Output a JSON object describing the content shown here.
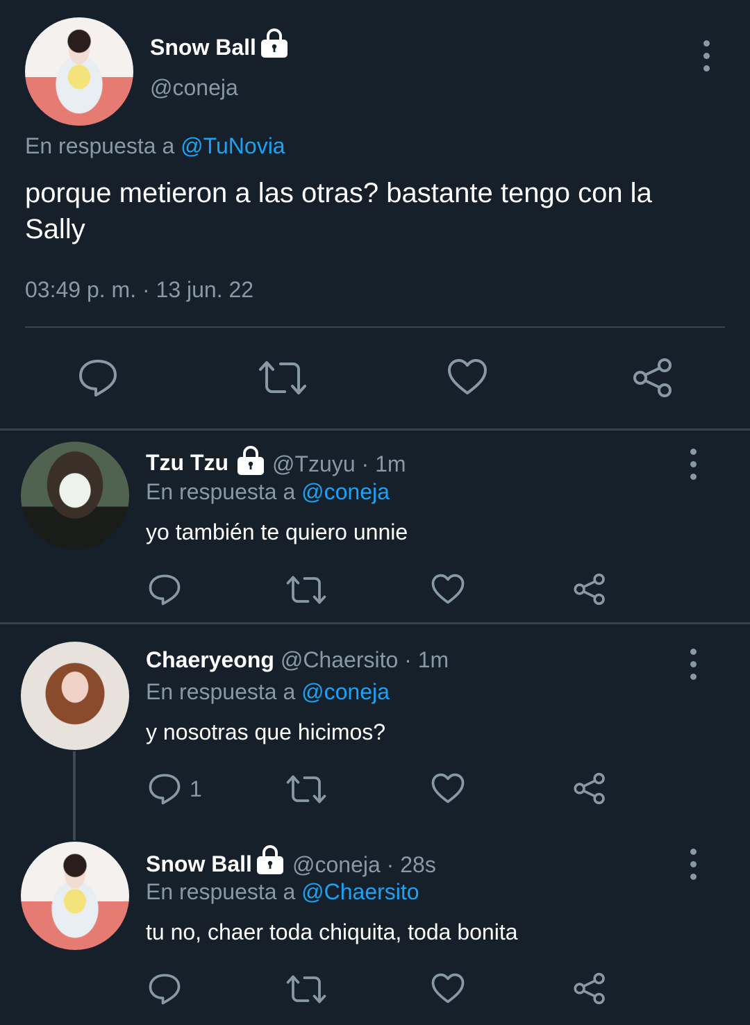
{
  "main_tweet": {
    "display_name": "Snow Ball",
    "handle": "@coneja",
    "reply_prefix": "En respuesta a",
    "reply_to": "@TuNovia",
    "text_line1": "porque metieron a las otras? bastante tengo con la",
    "text_line2": "Sally",
    "timestamp": "03:49 p. m. · 13 jun. 22"
  },
  "replies": [
    {
      "display_name": "Tzu Tzu",
      "handle": "@Tzuyu",
      "time": "· 1m",
      "reply_prefix": "En respuesta a",
      "reply_to": "@coneja",
      "text": "yo también te quiero unnie",
      "reply_count": ""
    },
    {
      "display_name": "Chaeryeong",
      "handle": "@Chaersito",
      "time": "· 1m",
      "reply_prefix": "En respuesta a",
      "reply_to": "@coneja",
      "text": "y nosotras que hicimos?",
      "reply_count": "1"
    },
    {
      "display_name": "Snow Ball",
      "handle": "@coneja",
      "time": "· 28s",
      "reply_prefix": "En respuesta a",
      "reply_to": "@Chaersito",
      "text": "tu no, chaer toda chiquita, toda bonita",
      "reply_count": ""
    }
  ],
  "icons": {
    "reply": "reply-icon",
    "retweet": "retweet-icon",
    "like": "heart-icon",
    "share": "share-icon",
    "more": "more-options-icon",
    "protected": "lock-icon"
  },
  "colors": {
    "background": "#15202b",
    "link": "#1da1f2",
    "muted": "#8899a6",
    "divider": "#38444d"
  }
}
